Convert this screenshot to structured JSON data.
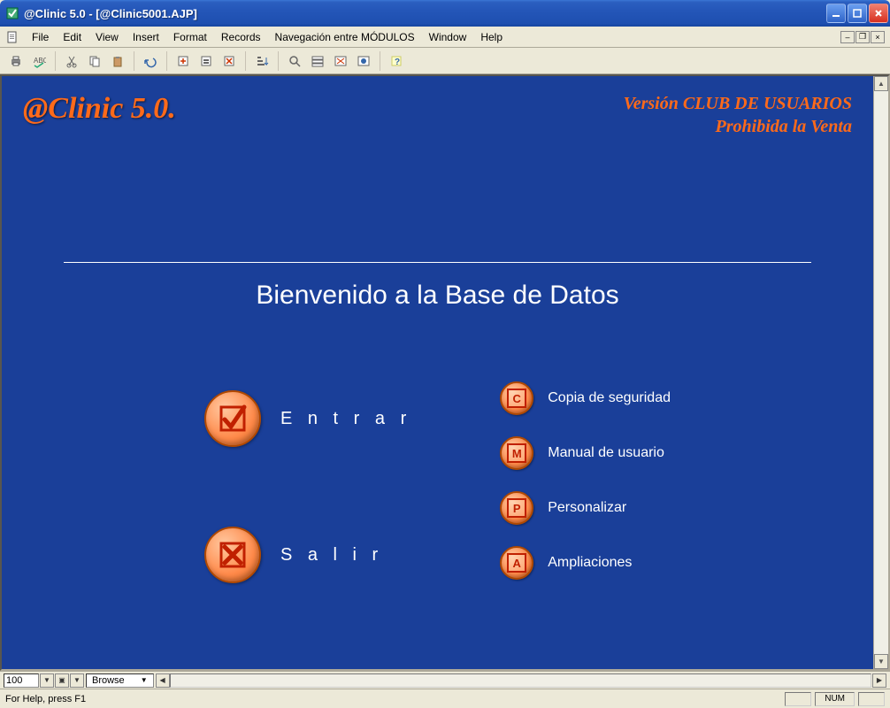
{
  "window": {
    "title": "@Clinic 5.0 - [@Clinic5001.AJP]"
  },
  "menu": {
    "items": [
      "File",
      "Edit",
      "View",
      "Insert",
      "Format",
      "Records",
      "Navegación entre MÓDULOS",
      "Window",
      "Help"
    ]
  },
  "brand": {
    "name": "@Clinic 5.0.",
    "version_line1": "Versión CLUB DE USUARIOS",
    "version_line2": "Prohibida la Venta"
  },
  "welcome": "Bienvenido a la Base de Datos",
  "big_actions": {
    "enter": "E n t r a r",
    "exit": "S a l i r"
  },
  "side_actions": [
    {
      "letter": "C",
      "label": "Copia de seguridad"
    },
    {
      "letter": "M",
      "label": "Manual de usuario"
    },
    {
      "letter": "P",
      "label": "Personalizar"
    },
    {
      "letter": "A",
      "label": "Ampliaciones"
    }
  ],
  "bottom": {
    "zoom": "100",
    "mode": "Browse"
  },
  "status": {
    "help": "For Help, press F1",
    "indicator": "NUM"
  }
}
